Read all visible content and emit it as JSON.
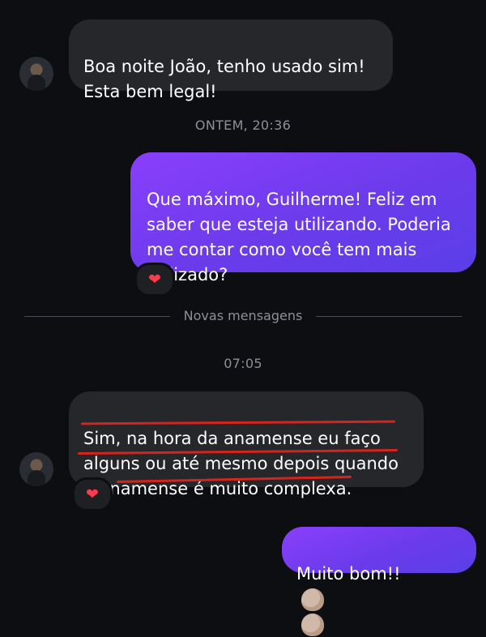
{
  "messages": [
    {
      "id": "m1",
      "direction": "incoming",
      "text": "Boa noite João, tenho usado sim!\nEsta bem legal!"
    },
    {
      "id": "m2",
      "direction": "outgoing",
      "text": "Que máximo, Guilherme! Feliz em\nsaber que esteja utilizando. Poderia\nme contar como você tem mais\nutilizado?",
      "reaction": "❤"
    },
    {
      "id": "m3",
      "direction": "incoming",
      "text": "Sim, na hora da anamense eu faço\nalguns ou até mesmo depois quando\na anamense é muito complexa.",
      "reaction": "❤"
    },
    {
      "id": "m4",
      "direction": "outgoing",
      "text": "Muito bom!!",
      "emoji": [
        "clapping-hands",
        "clapping-hands"
      ]
    }
  ],
  "timestamps": {
    "yesterday": "ONTEM, 20:36",
    "today": "07:05"
  },
  "divider": {
    "label": "Novas mensagens"
  },
  "colors": {
    "background": "#0d0e12",
    "incoming_bubble": "#26272b",
    "outgoing_bubble": "#7b3ff5",
    "reaction_heart": "#ff3b4e",
    "annotation_red": "#d6241c"
  }
}
